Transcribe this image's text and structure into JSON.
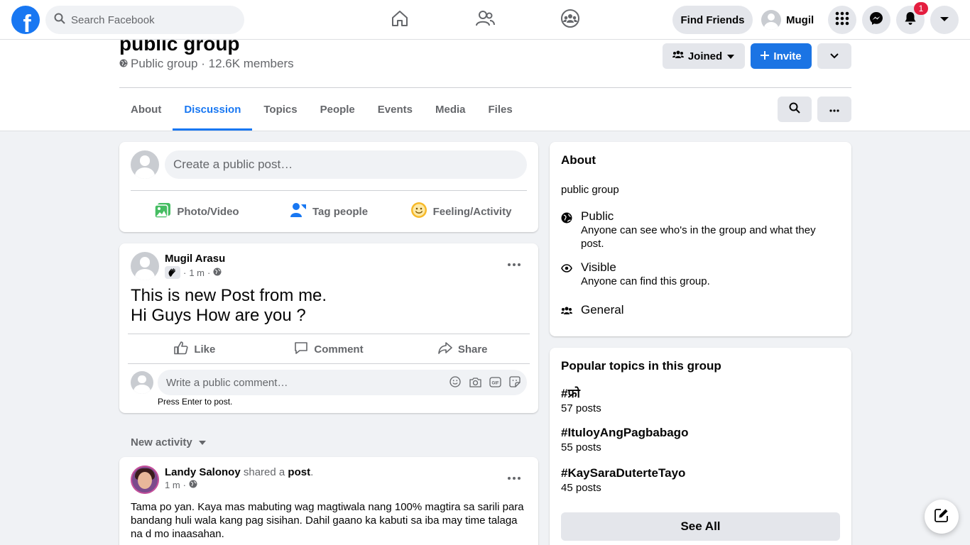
{
  "topnav": {
    "logo": "f",
    "search_placeholder": "Search Facebook",
    "find_friends": "Find Friends",
    "profile_name": "Mugil",
    "notification_count": "1"
  },
  "group": {
    "title": "public group",
    "meta": "Public group · 12.6K members",
    "joined_label": "Joined",
    "invite_label": "Invite",
    "tabs": [
      "About",
      "Discussion",
      "Topics",
      "People",
      "Events",
      "Media",
      "Files"
    ],
    "active_tab": "Discussion"
  },
  "composer": {
    "placeholder": "Create a public post…",
    "actions": [
      "Photo/Video",
      "Tag people",
      "Feeling/Activity"
    ]
  },
  "post1": {
    "author": "Mugil Arasu",
    "time": "1 m",
    "line1": "This is new Post from me.",
    "line2": "Hi Guys How are you ?",
    "like": "Like",
    "comment": "Comment",
    "share": "Share",
    "comment_placeholder": "Write a public comment…",
    "hint": "Press Enter to post."
  },
  "new_activity": "New activity",
  "post2": {
    "author": "Landy Salonoy",
    "shared_a": "shared a",
    "post_word": "post",
    "time": "1 m",
    "body": "Tama po yan. Kaya mas mabuting wag magtiwala nang 100% magtira sa sarili para bandang huli wala kang pag sisihan. Dahil gaano ka kabuti sa iba may time talaga na d mo inaasahan."
  },
  "about": {
    "title": "About",
    "description": "public group",
    "public_title": "Public",
    "public_desc": "Anyone can see who's in the group and what they post.",
    "visible_title": "Visible",
    "visible_desc": "Anyone can find this group.",
    "general": "General"
  },
  "topics": {
    "title": "Popular topics in this group",
    "items": [
      {
        "tag": "#फ्रो",
        "count": "57 posts"
      },
      {
        "tag": "#ItuloyAngPagbabago",
        "count": "55 posts"
      },
      {
        "tag": "#KaySaraDuterteTayo",
        "count": "45 posts"
      }
    ],
    "see_all": "See All"
  },
  "colors": {
    "brand": "#1877f2",
    "badge": "#e41e3f",
    "bg": "#f0f2f5"
  }
}
